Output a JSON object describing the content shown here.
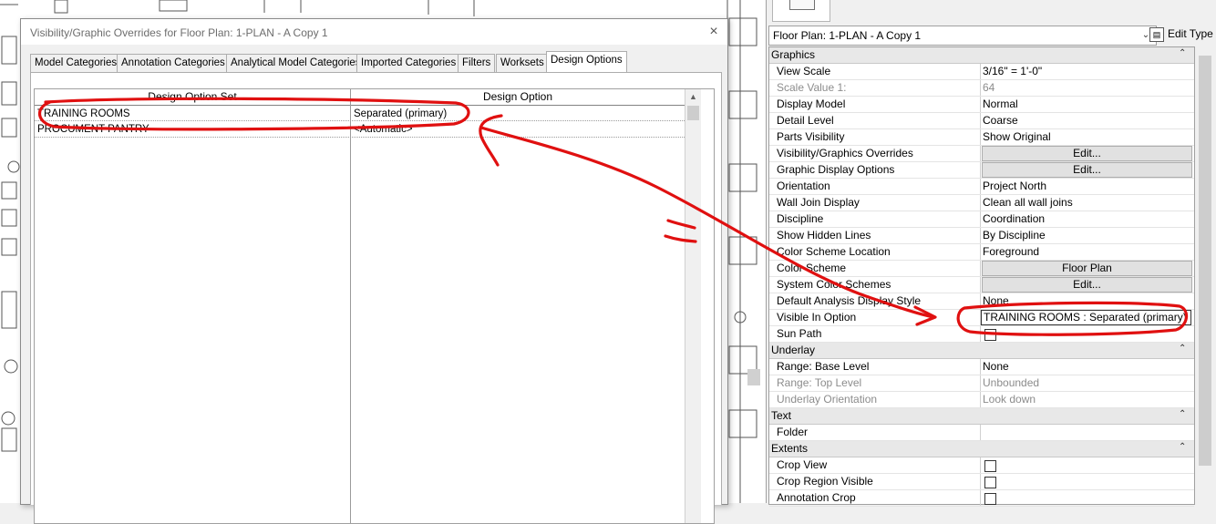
{
  "dialog": {
    "title": "Visibility/Graphic Overrides for Floor Plan: 1-PLAN - A Copy 1",
    "close_glyph": "×",
    "tabs": [
      {
        "label": "Model Categories"
      },
      {
        "label": "Annotation Categories"
      },
      {
        "label": "Analytical Model Categories"
      },
      {
        "label": "Imported Categories"
      },
      {
        "label": "Filters"
      },
      {
        "label": "Worksets"
      },
      {
        "label": "Design Options",
        "active": true
      }
    ],
    "grid": {
      "columns": [
        "Design Option Set",
        "Design Option"
      ],
      "rows": [
        {
          "set": "TRAINING ROOMS",
          "option": "Separated (primary)"
        },
        {
          "set": "PROCUMENT PANTRY",
          "option": "<Automatic>"
        }
      ]
    }
  },
  "properties": {
    "type_selector": "Floor Plan: 1-PLAN - A Copy 1",
    "edit_type_label": "Edit Type",
    "sections": [
      {
        "label": "Graphics",
        "rows": [
          {
            "name": "View Scale",
            "value": "3/16\" = 1'-0\""
          },
          {
            "name": "Scale Value    1:",
            "value": "64",
            "dim": true
          },
          {
            "name": "Display Model",
            "value": "Normal"
          },
          {
            "name": "Detail Level",
            "value": "Coarse"
          },
          {
            "name": "Parts Visibility",
            "value": "Show Original"
          },
          {
            "name": "Visibility/Graphics Overrides",
            "value": "Edit...",
            "button": true
          },
          {
            "name": "Graphic Display Options",
            "value": "Edit...",
            "button": true
          },
          {
            "name": "Orientation",
            "value": "Project North"
          },
          {
            "name": "Wall Join Display",
            "value": "Clean all wall joins"
          },
          {
            "name": "Discipline",
            "value": "Coordination"
          },
          {
            "name": "Show Hidden Lines",
            "value": "By Discipline"
          },
          {
            "name": "Color Scheme Location",
            "value": "Foreground"
          },
          {
            "name": "Color Scheme",
            "value": "Floor Plan",
            "button": true
          },
          {
            "name": "System Color Schemes",
            "value": "Edit...",
            "button": true
          },
          {
            "name": "Default Analysis Display Style",
            "value": "None"
          },
          {
            "name": "Visible In Option",
            "value": "TRAINING ROOMS : Separated (primary)",
            "boxed": true
          },
          {
            "name": "Sun Path",
            "checkbox": true
          }
        ]
      },
      {
        "label": "Underlay",
        "rows": [
          {
            "name": "Range: Base Level",
            "value": "None"
          },
          {
            "name": "Range: Top Level",
            "value": "Unbounded",
            "dim": true
          },
          {
            "name": "Underlay Orientation",
            "value": "Look down",
            "dim": true
          }
        ]
      },
      {
        "label": "Text",
        "rows": [
          {
            "name": "Folder",
            "value": ""
          }
        ]
      },
      {
        "label": "Extents",
        "rows": [
          {
            "name": "Crop View",
            "checkbox": true
          },
          {
            "name": "Crop Region Visible",
            "checkbox": true
          },
          {
            "name": "Annotation Crop",
            "checkbox": true
          }
        ]
      }
    ]
  },
  "annotation": {
    "marker_color": "#e01010"
  }
}
